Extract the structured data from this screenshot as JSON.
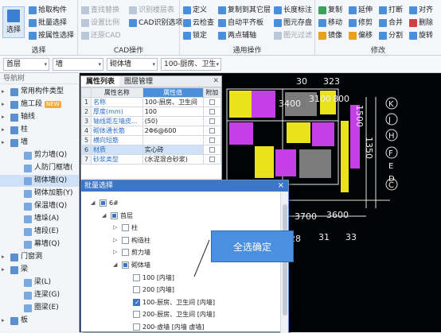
{
  "ribbon": {
    "select_group": {
      "big_button": "选择",
      "items": [
        "拾取构件",
        "批量选择",
        "按属性选择"
      ],
      "title": "选择"
    },
    "cad_group": {
      "items": [
        "查找替换",
        "识别楼层表",
        "设置比例",
        "CAD识别选项",
        "还原CAD"
      ],
      "title": "CAD操作"
    },
    "general_group": {
      "items": [
        "定义",
        "复制到其它层",
        "长度标注",
        "云检查",
        "自动平齐板",
        "图元存盘",
        "锁定",
        "两点辅轴",
        "图元过滤"
      ],
      "title": "通用操作"
    },
    "modify_group": {
      "items": [
        "复制",
        "延伸",
        "打断",
        "对齐",
        "移动",
        "修剪",
        "合并",
        "删除",
        "镜像",
        "偏移",
        "分割",
        "旋转"
      ],
      "title": "修改"
    }
  },
  "control_bar": {
    "floor": "首层",
    "category": "墙",
    "type": "砌体墙",
    "name": "100-厨房、卫生"
  },
  "nav": {
    "header": "导航树",
    "items": [
      {
        "label": "常用构件类型",
        "level": "top"
      },
      {
        "label": "施工段",
        "level": "top",
        "tag": "NEW"
      },
      {
        "label": "轴线",
        "level": "top"
      },
      {
        "label": "柱",
        "level": "top"
      },
      {
        "label": "墙",
        "level": "top"
      },
      {
        "label": "剪力墙(Q)",
        "level": "sub"
      },
      {
        "label": "人防门框墙(",
        "level": "sub"
      },
      {
        "label": "砌体墙(Q)",
        "level": "sub",
        "selected": true
      },
      {
        "label": "砌体加筋(Y)",
        "level": "sub"
      },
      {
        "label": "保温墙(Q)",
        "level": "sub"
      },
      {
        "label": "墙垛(A)",
        "level": "sub"
      },
      {
        "label": "墙段(E)",
        "level": "sub"
      },
      {
        "label": "幕墙(Q)",
        "level": "sub"
      },
      {
        "label": "门窗洞",
        "level": "top"
      },
      {
        "label": "梁",
        "level": "top"
      },
      {
        "label": "梁(L)",
        "level": "sub"
      },
      {
        "label": "连梁(G)",
        "level": "sub"
      },
      {
        "label": "圈梁(E)",
        "level": "sub"
      },
      {
        "label": "板",
        "level": "top"
      }
    ]
  },
  "props_panel": {
    "tabs": [
      "属性列表",
      "图层管理"
    ],
    "headers": [
      "属性名称",
      "属性值",
      "附加"
    ],
    "rows": [
      {
        "n": "1",
        "name": "名称",
        "value": "100-厨房、卫生间"
      },
      {
        "n": "2",
        "name": "厚度(mm)",
        "value": "100"
      },
      {
        "n": "3",
        "name": "轴线距左墙皮...",
        "value": "(50)"
      },
      {
        "n": "4",
        "name": "砌体通长筋",
        "value": "2Φ6@600"
      },
      {
        "n": "5",
        "name": "横向短筋",
        "value": ""
      },
      {
        "n": "6",
        "name": "材质",
        "value": "实心砖"
      },
      {
        "n": "7",
        "name": "砂浆类型",
        "value": "(水泥混合砂浆)"
      }
    ]
  },
  "dialog": {
    "title": "批量选择",
    "close": "×",
    "tree": [
      {
        "label": "6#",
        "indent": 0,
        "toggle": "◢",
        "state": "part"
      },
      {
        "label": "首层",
        "indent": 1,
        "toggle": "◢",
        "state": "part"
      },
      {
        "label": "柱",
        "indent": 2,
        "toggle": "▷",
        "state": "off"
      },
      {
        "label": "构造柱",
        "indent": 2,
        "toggle": "▷",
        "state": "off"
      },
      {
        "label": "剪力墙",
        "indent": 2,
        "toggle": "▷",
        "state": "off"
      },
      {
        "label": "砌体墙",
        "indent": 2,
        "toggle": "◢",
        "state": "part"
      },
      {
        "label": "100 [内墙]",
        "indent": 3,
        "toggle": "",
        "state": "off"
      },
      {
        "label": "200 [内墙]",
        "indent": 3,
        "toggle": "",
        "state": "off"
      },
      {
        "label": "100-厨房、卫生间 [内墙]",
        "indent": 3,
        "toggle": "",
        "state": "on"
      },
      {
        "label": "200-厨房、卫生间 [内墙]",
        "indent": 3,
        "toggle": "",
        "state": "off"
      },
      {
        "label": "200-虚墙 [内墙 虚墙]",
        "indent": 3,
        "toggle": "",
        "state": "off"
      }
    ]
  },
  "callout": "全选确定",
  "canvas_labels": [
    "30",
    "323",
    "3400",
    "3100",
    "800",
    "3700",
    "3600",
    "28",
    "31",
    "33",
    "1350",
    "1500"
  ],
  "axis_letters": [
    "K",
    "J",
    "H",
    "F",
    "E",
    "D",
    "C",
    "B",
    "A"
  ]
}
